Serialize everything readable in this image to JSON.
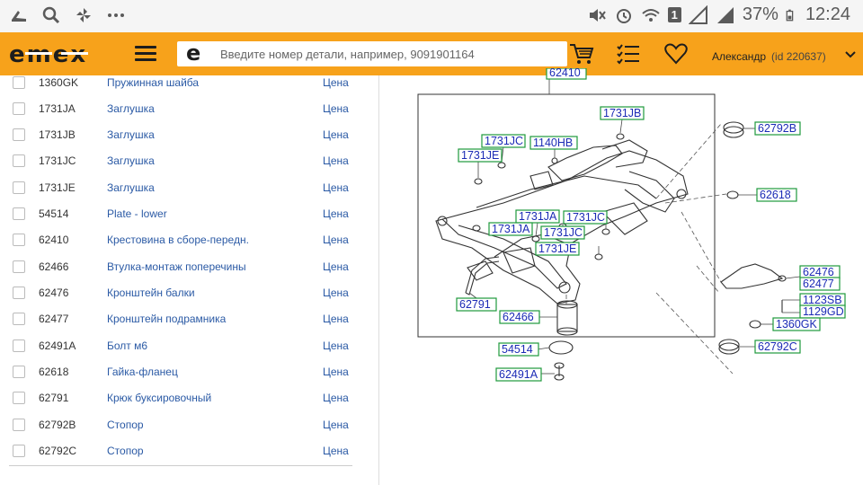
{
  "status_bar": {
    "battery": "37%",
    "time": "12:24",
    "sim_badge": "1",
    "icons": [
      "boot-icon",
      "search-icon",
      "pinwheel-icon",
      "more-icon",
      "mute-icon",
      "alarm-icon",
      "wifi-icon",
      "signal-icon",
      "battery-icon"
    ]
  },
  "header": {
    "logo": "EMEX",
    "search_icon_letter": "e",
    "search_placeholder": "Введите номер детали, например, 9091901164",
    "user_name": "Александр",
    "user_id": "(id 220637)",
    "brand_color": "#f7a21b"
  },
  "parts": [
    {
      "code": "1360GK",
      "name": "Пружинная шайба",
      "price": "Цена"
    },
    {
      "code": "1731JA",
      "name": "Заглушка",
      "price": "Цена"
    },
    {
      "code": "1731JB",
      "name": "Заглушка",
      "price": "Цена"
    },
    {
      "code": "1731JC",
      "name": "Заглушка",
      "price": "Цена"
    },
    {
      "code": "1731JE",
      "name": "Заглушка",
      "price": "Цена"
    },
    {
      "code": "54514",
      "name": "Plate - lower",
      "price": "Цена"
    },
    {
      "code": "62410",
      "name": "Крестовина в сборе-передн.",
      "price": "Цена"
    },
    {
      "code": "62466",
      "name": "Втулка-монтаж поперечины",
      "price": "Цена"
    },
    {
      "code": "62476",
      "name": "Кронштейн балки",
      "price": "Цена"
    },
    {
      "code": "62477",
      "name": "Кронштейн подрамника",
      "price": "Цена"
    },
    {
      "code": "62491A",
      "name": "Болт м6",
      "price": "Цена"
    },
    {
      "code": "62618",
      "name": "Гайка-фланец",
      "price": "Цена"
    },
    {
      "code": "62791",
      "name": "Крюк буксировочный",
      "price": "Цена"
    },
    {
      "code": "62792B",
      "name": "Стопор",
      "price": "Цена"
    },
    {
      "code": "62792C",
      "name": "Стопор",
      "price": "Цена"
    }
  ],
  "diagram": {
    "top_label": "62410",
    "labels": [
      "1731JB",
      "1731JC",
      "1140HB",
      "1731JE",
      "1731JA",
      "1731JC",
      "1731JA",
      "1731JC",
      "1731JE",
      "62791",
      "62466",
      "54514",
      "62491A",
      "62792B",
      "62618",
      "62476",
      "62477",
      "1123SB",
      "1129GD",
      "1360GK",
      "62792C"
    ]
  }
}
